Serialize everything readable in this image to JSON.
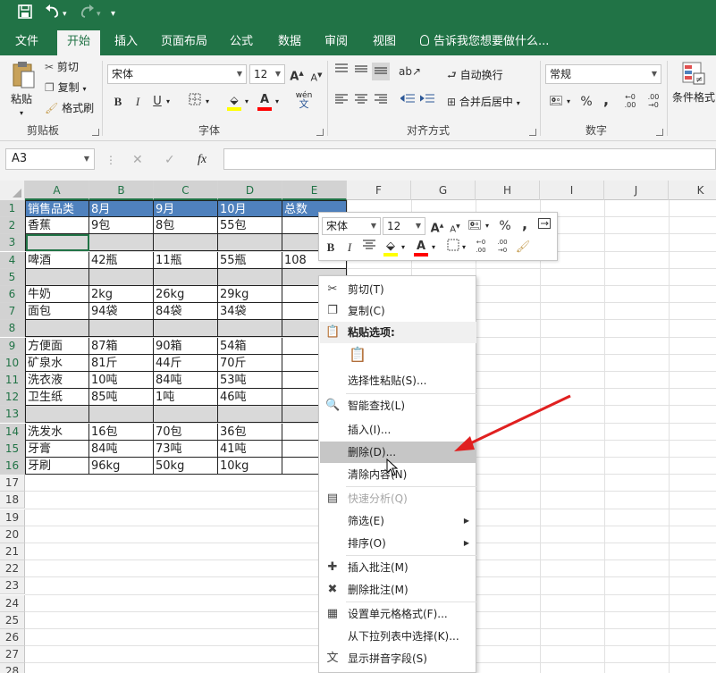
{
  "quick_access": {
    "save_icon": "save-icon",
    "undo_icon": "undo-icon",
    "redo_icon": "redo-icon",
    "customize_icon": "chevron-down-icon"
  },
  "tabs": [
    {
      "label": "文件"
    },
    {
      "label": "开始"
    },
    {
      "label": "插入"
    },
    {
      "label": "页面布局"
    },
    {
      "label": "公式"
    },
    {
      "label": "数据"
    },
    {
      "label": "审阅"
    },
    {
      "label": "视图"
    }
  ],
  "tell_me": "告诉我您想要做什么...",
  "ribbon": {
    "clipboard": {
      "paste": "粘贴",
      "cut": "剪切",
      "copy": "复制",
      "format_painter": "格式刷",
      "label": "剪贴板"
    },
    "font": {
      "font_name": "宋体",
      "font_size": "12",
      "bold": "B",
      "italic": "I",
      "underline": "U",
      "label": "字体",
      "grow": "A",
      "shrink": "A",
      "phonetic": "wén"
    },
    "alignment": {
      "wrap": "自动换行",
      "merge": "合并后居中",
      "label": "对齐方式"
    },
    "number": {
      "format": "常规",
      "percent": "%",
      "comma": ",",
      "label": "数字",
      "inc": "←0 .00",
      "dec": ".00 →0"
    },
    "styles": {
      "cond": "条件格式"
    }
  },
  "formula_bar": {
    "name_box": "A3",
    "fx": "fx",
    "cancel": "✕",
    "enter": "✓"
  },
  "columns": [
    "A",
    "B",
    "C",
    "D",
    "E",
    "F",
    "G",
    "H",
    "I",
    "J",
    "K"
  ],
  "rows": [
    {
      "n": "1",
      "kind": "hdr",
      "cells": [
        "销售品类",
        "8月",
        "9月",
        "10月",
        "总数"
      ]
    },
    {
      "n": "2",
      "kind": "normal",
      "cells": [
        "香蕉",
        "9包",
        "8包",
        "55包",
        ""
      ]
    },
    {
      "n": "3",
      "kind": "blank",
      "cells": [
        "",
        "",
        "",
        "",
        ""
      ]
    },
    {
      "n": "4",
      "kind": "normal",
      "cells": [
        "啤酒",
        "42瓶",
        "11瓶",
        "55瓶",
        "108"
      ]
    },
    {
      "n": "5",
      "kind": "blank",
      "cells": [
        "",
        "",
        "",
        "",
        ""
      ]
    },
    {
      "n": "6",
      "kind": "normal",
      "cells": [
        "牛奶",
        "2kg",
        "26kg",
        "29kg",
        ""
      ]
    },
    {
      "n": "7",
      "kind": "normal",
      "cells": [
        "面包",
        "94袋",
        "84袋",
        "34袋",
        ""
      ]
    },
    {
      "n": "8",
      "kind": "blank",
      "cells": [
        "",
        "",
        "",
        "",
        ""
      ]
    },
    {
      "n": "9",
      "kind": "normal",
      "cells": [
        "方便面",
        "87箱",
        "90箱",
        "54箱",
        ""
      ]
    },
    {
      "n": "10",
      "kind": "normal",
      "cells": [
        "矿泉水",
        "81斤",
        "44斤",
        "70斤",
        ""
      ]
    },
    {
      "n": "11",
      "kind": "normal",
      "cells": [
        "洗衣液",
        "10吨",
        "84吨",
        "53吨",
        ""
      ]
    },
    {
      "n": "12",
      "kind": "normal",
      "cells": [
        "卫生纸",
        "85吨",
        "1吨",
        "46吨",
        ""
      ]
    },
    {
      "n": "13",
      "kind": "blank",
      "cells": [
        "",
        "",
        "",
        "",
        ""
      ]
    },
    {
      "n": "14",
      "kind": "normal",
      "cells": [
        "洗发水",
        "16包",
        "70包",
        "36包",
        ""
      ]
    },
    {
      "n": "15",
      "kind": "normal",
      "cells": [
        "牙膏",
        "84吨",
        "73吨",
        "41吨",
        ""
      ]
    },
    {
      "n": "16",
      "kind": "normal",
      "cells": [
        "牙刷",
        "96kg",
        "50kg",
        "10kg",
        ""
      ]
    },
    {
      "n": "17"
    },
    {
      "n": "18"
    },
    {
      "n": "19"
    },
    {
      "n": "20"
    },
    {
      "n": "21"
    },
    {
      "n": "22"
    },
    {
      "n": "23"
    },
    {
      "n": "24"
    },
    {
      "n": "25"
    },
    {
      "n": "26"
    },
    {
      "n": "27"
    },
    {
      "n": "28"
    }
  ],
  "mini_toolbar": {
    "font": "宋体",
    "size": "12",
    "percent": "%",
    "comma": ",",
    "bold": "B",
    "italic": "I"
  },
  "context_menu": [
    {
      "label": "剪切(T)",
      "icon": "scissors-icon"
    },
    {
      "label": "复制(C)",
      "icon": "copy-icon"
    },
    {
      "label": "粘贴选项:",
      "icon": "paste-icon",
      "section": true
    },
    {
      "label": "",
      "icon": "paste-icon"
    },
    {
      "label": "选择性粘贴(S)...",
      "icon": ""
    },
    {
      "label": "智能查找(L)",
      "icon": "smart-lookup-icon"
    },
    {
      "label": "插入(I)...",
      "icon": ""
    },
    {
      "label": "删除(D)...",
      "icon": "",
      "highlight": true
    },
    {
      "label": "清除内容(N)",
      "icon": ""
    },
    {
      "label": "快速分析(Q)",
      "icon": "quick-analysis-icon",
      "disabled": true
    },
    {
      "label": "筛选(E)",
      "icon": "",
      "submenu": true
    },
    {
      "label": "排序(O)",
      "icon": "",
      "submenu": true
    },
    {
      "label": "插入批注(M)",
      "icon": "insert-comment-icon"
    },
    {
      "label": "删除批注(M)",
      "icon": "delete-comment-icon"
    },
    {
      "label": "设置单元格格式(F)...",
      "icon": "format-cells-icon"
    },
    {
      "label": "从下拉列表中选择(K)...",
      "icon": ""
    },
    {
      "label": "显示拼音字段(S)",
      "icon": "phonetic-icon"
    }
  ],
  "colors": {
    "excel_green": "#217346",
    "header_fill": "#4f81bd",
    "blank_fill": "#d9d9d9",
    "arrow": "#e02020"
  }
}
